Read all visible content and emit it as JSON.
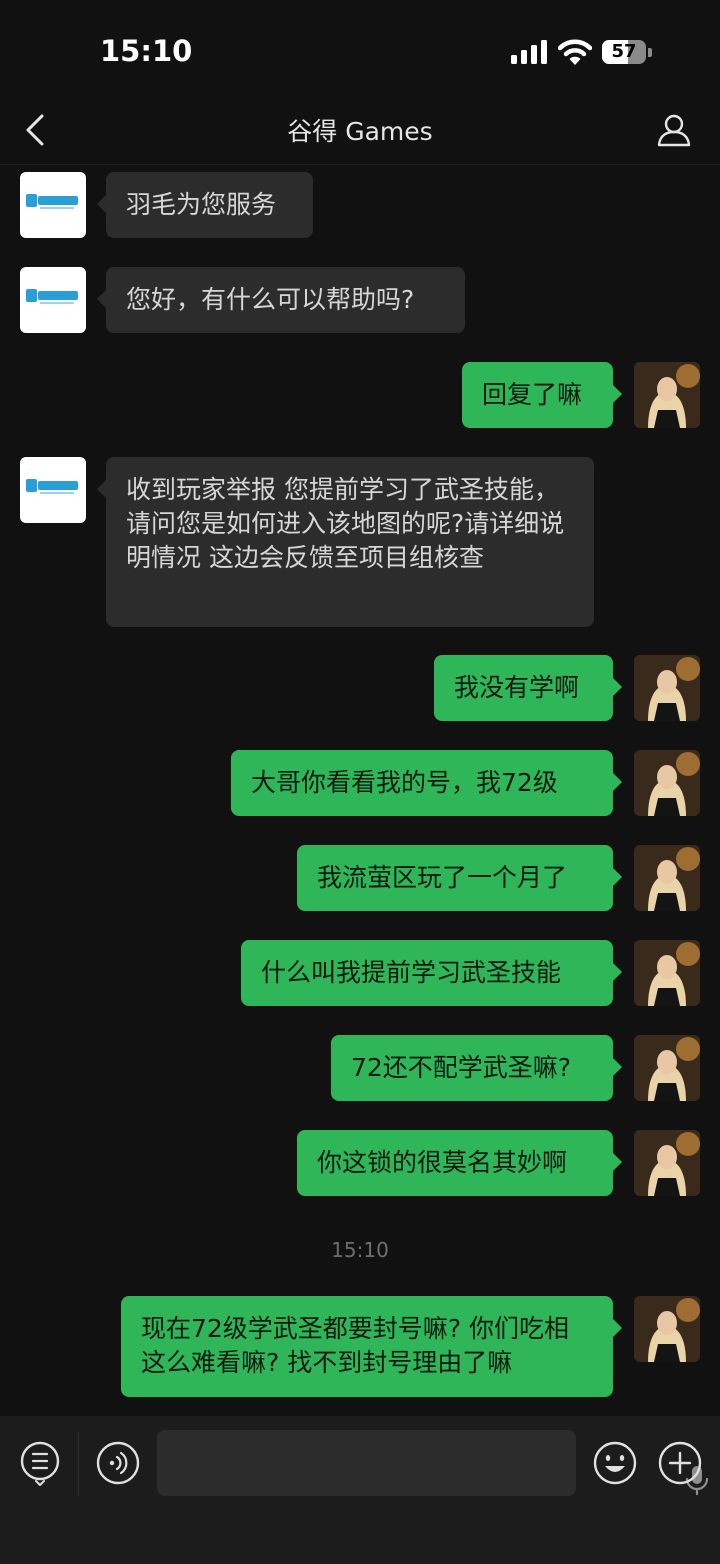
{
  "status_bar": {
    "time": "15:10",
    "battery": "57"
  },
  "nav": {
    "title": "谷得 Games",
    "back_icon": "chevron-left-icon",
    "profile_icon": "person-icon"
  },
  "messages": [
    {
      "side": "in",
      "text": "羽毛为您服务"
    },
    {
      "side": "in",
      "text": "您好，有什么可以帮助吗?"
    },
    {
      "side": "out",
      "text": "回复了嘛"
    },
    {
      "side": "in",
      "text": "收到玩家举报 您提前学习了武圣技能，请问您是如何进入该地图的呢?请详细说明情况 这边会反馈至项目组核查"
    },
    {
      "side": "out",
      "text": "我没有学啊"
    },
    {
      "side": "out",
      "text": "大哥你看看我的号，我72级"
    },
    {
      "side": "out",
      "text": "我流萤区玩了一个月了"
    },
    {
      "side": "out",
      "text": "什么叫我提前学习武圣技能"
    },
    {
      "side": "out",
      "text": "72还不配学武圣嘛?"
    },
    {
      "side": "out",
      "text": "你这锁的很莫名其妙啊"
    },
    {
      "side": "out",
      "text": "现在72级学武圣都要封号嘛? 你们吃相这么难看嘛? 找不到封号理由了嘛"
    }
  ],
  "timestamp": "15:10",
  "input_bar": {
    "menu_icon": "menu-icon",
    "voice_icon": "voice-icon",
    "mic_icon": "mic-icon",
    "emoji_icon": "emoji-icon",
    "plus_icon": "plus-icon"
  },
  "colors": {
    "background": "#111111",
    "incoming_bubble": "#2c2c2c",
    "outgoing_bubble": "#2fb659"
  }
}
